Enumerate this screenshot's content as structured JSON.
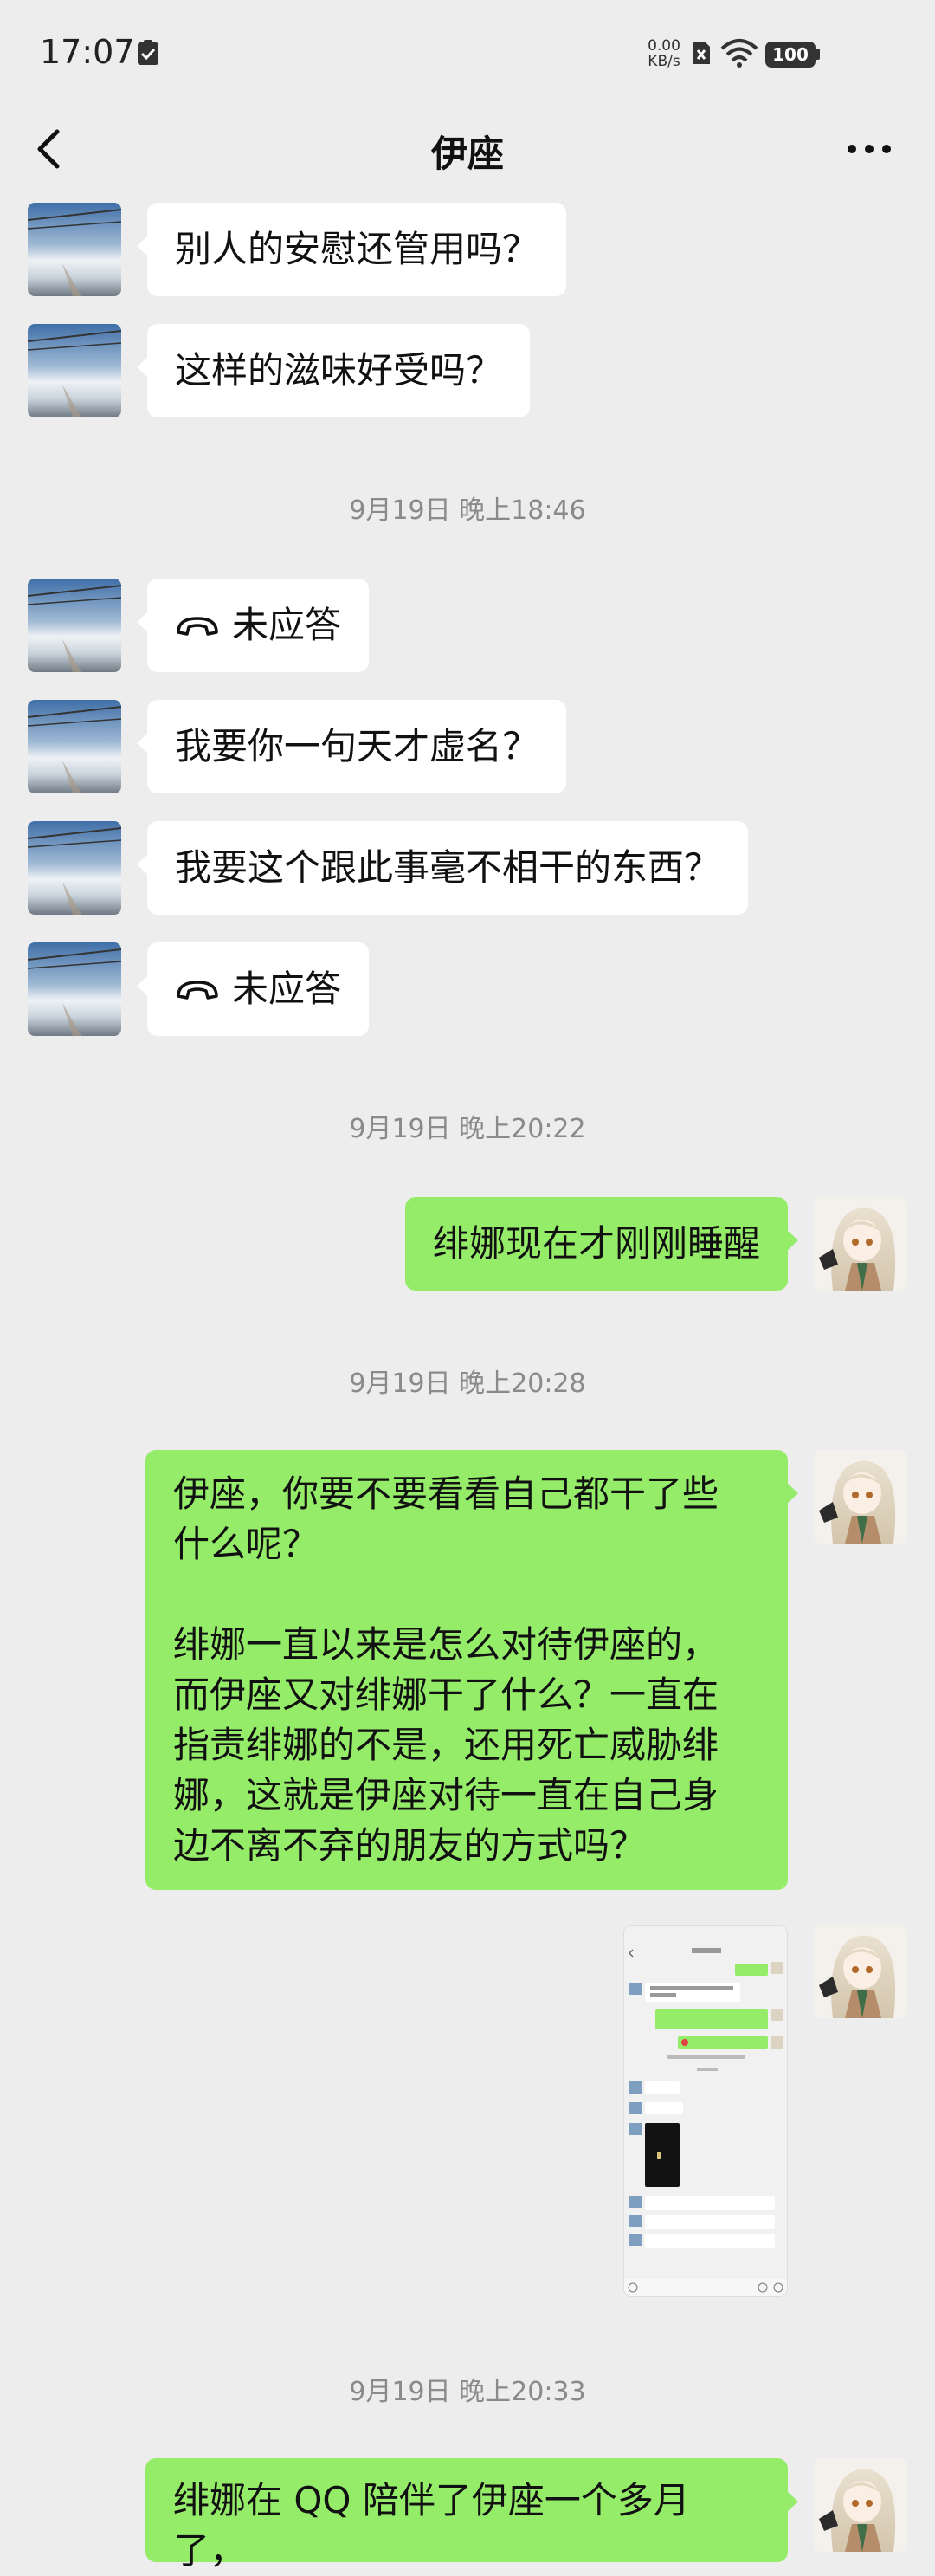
{
  "status_bar": {
    "time": "17:07",
    "net_speed_value": "0.00",
    "net_speed_unit": "KB/s",
    "battery": "100",
    "icons": [
      "check-clipboard-icon",
      "sim-x-icon",
      "wifi-icon",
      "battery-icon"
    ]
  },
  "header": {
    "title": "伊座",
    "back_icon": "chevron-left-icon",
    "more_icon": "more-dots-icon"
  },
  "messages": [
    {
      "from": "contact",
      "text": "别人的安慰还管用吗？"
    },
    {
      "from": "contact",
      "text": "这样的滋味好受吗？"
    },
    {
      "type": "timestamp",
      "text": "9月19日 晚上18:46"
    },
    {
      "from": "contact",
      "type": "call",
      "text": "未应答"
    },
    {
      "from": "contact",
      "text": "我要你一句天才虚名？"
    },
    {
      "from": "contact",
      "text": "我要这个跟此事毫不相干的东西？"
    },
    {
      "from": "contact",
      "type": "call",
      "text": "未应答"
    },
    {
      "type": "timestamp",
      "text": "9月19日 晚上20:22"
    },
    {
      "from": "me",
      "text": "绯娜现在才刚刚睡醒"
    },
    {
      "type": "timestamp",
      "text": "9月19日 晚上20:28"
    },
    {
      "from": "me",
      "lines": [
        "伊座，你要不要看看自己都干了些",
        "什么呢？",
        "",
        "绯娜一直以来是怎么对待伊座的，",
        "而伊座又对绯娜干了什么？一直在",
        "指责绯娜的不是，还用死亡威胁绯",
        "娜，这就是伊座对待一直在自己身",
        "边不离不弃的朋友的方式吗？"
      ]
    },
    {
      "from": "me",
      "type": "image",
      "description": "chat-screenshot-thumbnail"
    },
    {
      "type": "timestamp",
      "text": "9月19日 晚上20:33"
    },
    {
      "from": "me",
      "text": "绯娜在 QQ 陪伴了伊座一个多月了，"
    }
  ],
  "colors": {
    "background": "#ededed",
    "incoming_bubble": "#ffffff",
    "outgoing_bubble": "#95ec69",
    "timestamp_text": "#8a8a8a"
  }
}
